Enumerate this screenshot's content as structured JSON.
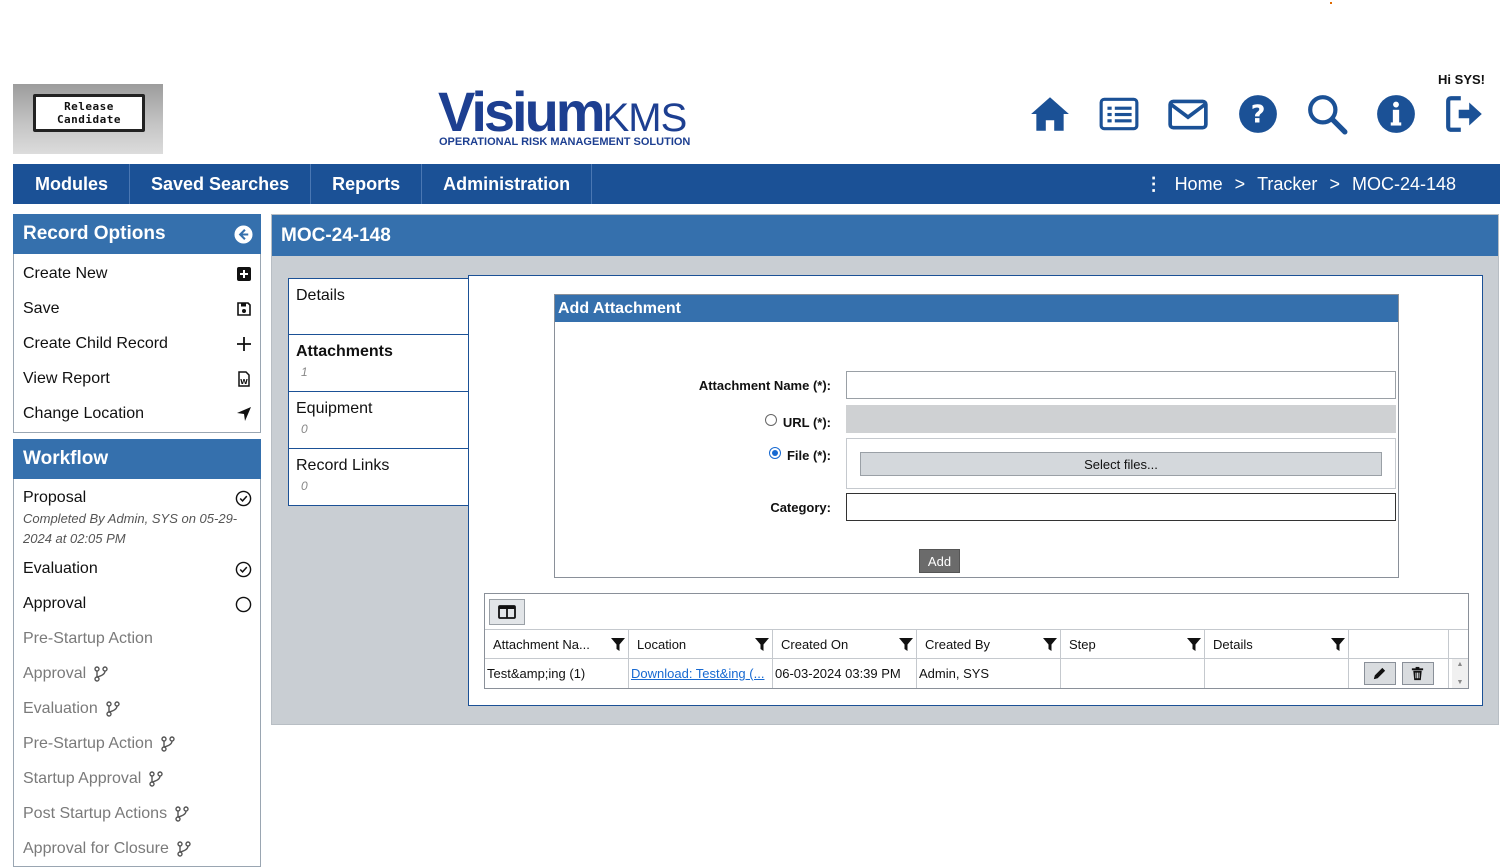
{
  "header": {
    "badge_line1": "Release",
    "badge_line2": "Candidate",
    "logo_visium": "Visium",
    "logo_kms": "KMS",
    "logo_tagline": "OPERATIONAL RISK MANAGEMENT SOLUTION",
    "greeting": "Hi SYS!",
    "icons": [
      "home-icon",
      "list-icon",
      "mail-icon",
      "help-icon",
      "search-icon",
      "info-icon",
      "logout-icon"
    ],
    "brand_color": "#1b5196"
  },
  "nav": {
    "items": [
      "Modules",
      "Saved Searches",
      "Reports",
      "Administration"
    ],
    "breadcrumb": [
      "Home",
      "Tracker",
      "MOC-24-148"
    ],
    "sep": ">",
    "dots": "⋮"
  },
  "record_options": {
    "title": "Record Options",
    "items": [
      "Create New",
      "Save",
      "Create Child Record",
      "View Report",
      "Change Location"
    ]
  },
  "workflow": {
    "title": "Workflow",
    "steps": [
      {
        "label": "Proposal",
        "note": "Completed By Admin, SYS on 05-29-2024 at 02:05 PM"
      },
      {
        "label": "Evaluation"
      },
      {
        "label": "Approval"
      },
      {
        "label": "Pre-Startup Action"
      },
      {
        "label": "Approval"
      },
      {
        "label": "Evaluation"
      },
      {
        "label": "Pre-Startup Action"
      },
      {
        "label": "Startup Approval"
      },
      {
        "label": "Post Startup Actions"
      },
      {
        "label": "Approval for Closure"
      }
    ]
  },
  "main": {
    "title": "MOC-24-148",
    "tabs": [
      {
        "label": "Details",
        "count": ""
      },
      {
        "label": "Attachments",
        "count": "1"
      },
      {
        "label": "Equipment",
        "count": "0"
      },
      {
        "label": "Record Links",
        "count": "0"
      }
    ]
  },
  "attachment_form": {
    "title": "Add Attachment",
    "name_label": "Attachment Name (*):",
    "name_value": "",
    "url_label": "URL (*):",
    "file_label": "File (*):",
    "select_files": "Select files...",
    "category_label": "Category:",
    "category_value": "",
    "add_button": "Add"
  },
  "grid": {
    "columns": [
      "Attachment Na...",
      "Location",
      "Created On",
      "Created By",
      "Step",
      "Details"
    ],
    "rows": [
      {
        "name": "Test&amp;ing (1)",
        "location": "Download: Test&ing (...",
        "created_on": "06-03-2024 03:39 PM",
        "created_by": "Admin, SYS",
        "step": "",
        "details": ""
      }
    ]
  }
}
